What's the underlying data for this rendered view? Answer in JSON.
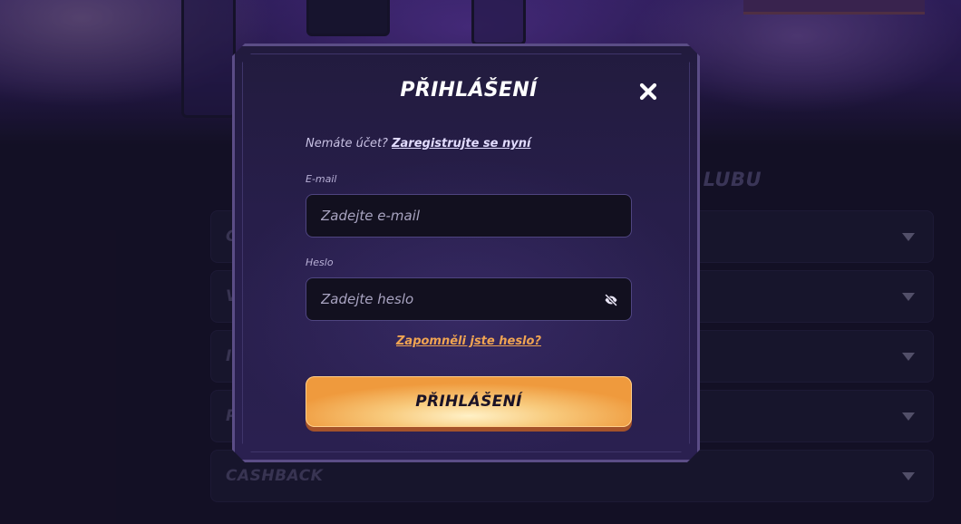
{
  "background": {
    "section_title": "LUBU",
    "accordion": [
      {
        "label": "C"
      },
      {
        "label": "V"
      },
      {
        "label": "I"
      },
      {
        "label": "P"
      },
      {
        "label": "CASHBACK"
      }
    ]
  },
  "modal": {
    "title": "PŘIHLÁŠENÍ",
    "close_icon": "close-icon",
    "signup_prompt": "Nemáte účet?",
    "signup_link": "Zaregistrujte se nyní",
    "email": {
      "label": "E-mail",
      "placeholder": "Zadejte e-mail",
      "value": ""
    },
    "password": {
      "label": "Heslo",
      "placeholder": "Zadejte heslo",
      "value": "",
      "toggle_icon": "eye-off-icon"
    },
    "forgot_link": "Zapomněli jste heslo?",
    "submit_label": "PŘIHLÁŠENÍ"
  },
  "colors": {
    "accent_orange": "#ef9a3d",
    "forgot_link": "#f0a452",
    "modal_border": "#5b4d86",
    "page_bg": "#17132a"
  }
}
